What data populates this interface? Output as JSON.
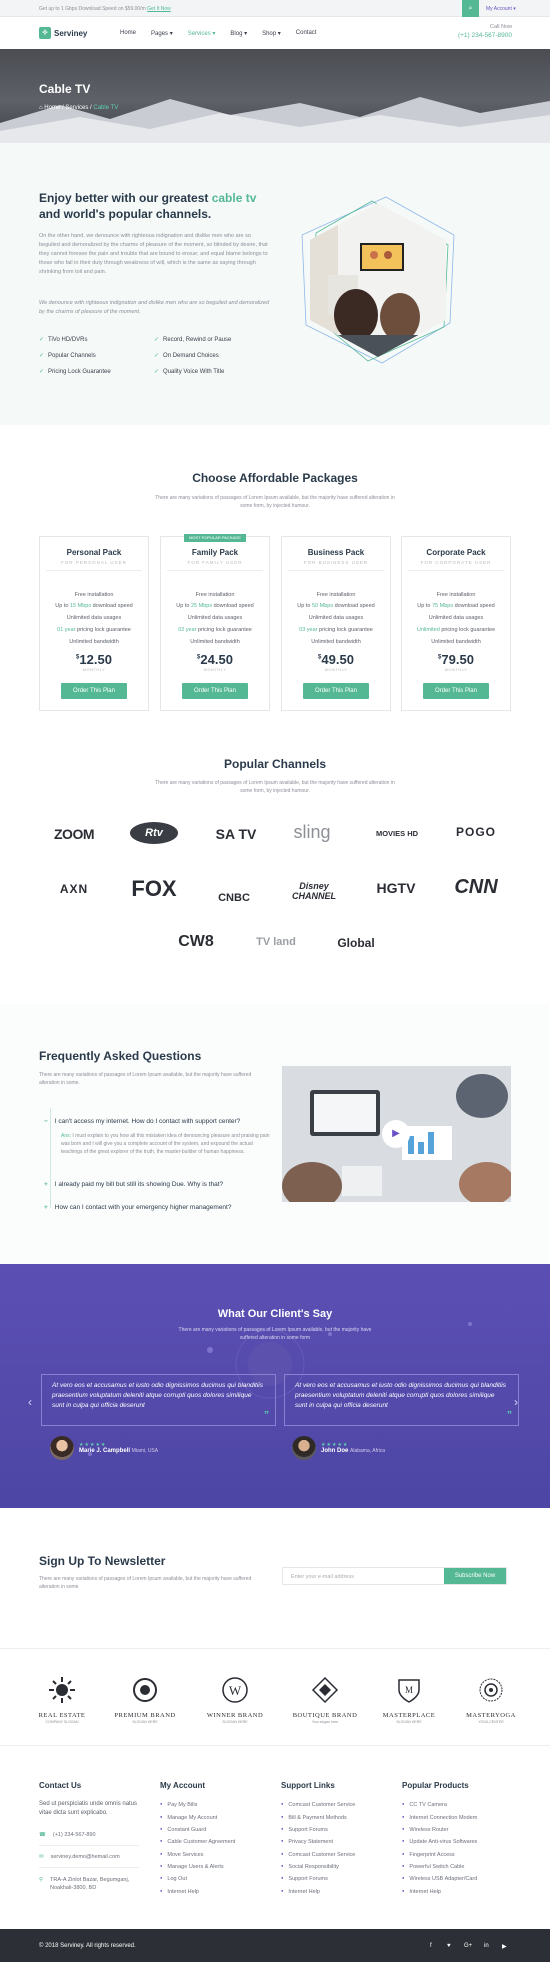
{
  "topbar": {
    "promo": "Get up to 1 Gbps Download Speed on $59.00/m",
    "promo_link": "Get It Now",
    "account": "My Account ▾"
  },
  "header": {
    "brand": "Servineу",
    "nav": [
      "Home",
      "Pages ▾",
      "Services ▾",
      "Blog ▾",
      "Shop ▾",
      "Contact"
    ],
    "call_label": "Call Now",
    "call_number": "(+1) 234-567-8900"
  },
  "hero": {
    "title": "Cable TV",
    "breadcrumb": [
      "Home",
      "/",
      "Services",
      "/",
      "Cable TV"
    ]
  },
  "about": {
    "title_a": "Enjoy better with our greatest ",
    "title_hl": "cable tv",
    "title_b": " and world's popular channels.",
    "para1": "On the other hand, we denounce with righteous indignation and dislike men who are so beguiled and demoralized by the charms of pleasure of the moment, so blinded by desire, that they cannot foresee the pain and trouble that are bound to ensue; and equal blame belongs to those who fail in their duty through weakness of will, which is the same as saying through shrinking from toil and pain.",
    "para2": "We denounce with righteous indignation and dislike men who are so beguiled and demoralized by the charms of pleasure of the moment.",
    "features": [
      "TiVo HD/DVRs",
      "Record, Rewind or Pause",
      "Popular Channels",
      "On Demand Choices",
      "Pricing Lock Guarantee",
      "Quality Voice With Title"
    ]
  },
  "packages": {
    "title": "Choose Affordable Packages",
    "subtitle": "There are many variations of passages of Lorem Ipsum available, but the majority have suffered alteration in some form, by injected humour.",
    "plans": [
      {
        "name": "Personal Pack",
        "sub": "FOR PERSONAL USER",
        "tag": "",
        "f1": "Free installation",
        "f2a": "Up to ",
        "f2b": "15 Mbps",
        "f2c": " download speed",
        "f3": "Unlimited data usages",
        "f4a": "01 year",
        "f4b": " pricing lock guarantee",
        "f5": "Unlimited bandwidth",
        "currency": "$",
        "price": "12.50",
        "period": "MONTHLY",
        "cta": "Order This Plan"
      },
      {
        "name": "Family Pack",
        "sub": "FOR FAMILY USER",
        "tag": "MOST POPULAR PACKAGE",
        "f1": "Free installation",
        "f2a": "Up to ",
        "f2b": "25 Mbps",
        "f2c": " download speed",
        "f3": "Unlimited data usages",
        "f4a": "02 year",
        "f4b": " pricing lock guarantee",
        "f5": "Unlimited bandwidth",
        "currency": "$",
        "price": "24.50",
        "period": "MONTHLY",
        "cta": "Order This Plan"
      },
      {
        "name": "Business Pack",
        "sub": "FOR BUSINESS USER",
        "tag": "",
        "f1": "Free installation",
        "f2a": "Up to ",
        "f2b": "50 Mbps",
        "f2c": " download speed",
        "f3": "Unlimited data usages",
        "f4a": "03 year",
        "f4b": " pricing lock guarantee",
        "f5": "Unlimited bandwidth",
        "currency": "$",
        "price": "49.50",
        "period": "MONTHLY",
        "cta": "Order This Plan"
      },
      {
        "name": "Corporate Pack",
        "sub": "FOR CORPORATE USER",
        "tag": "",
        "f1": "Free installation",
        "f2a": "Up to ",
        "f2b": "75 Mbps",
        "f2c": " download speed",
        "f3": "Unlimited data usages",
        "f4a": "Unlimited",
        "f4b": " pricing lock guarantee",
        "f5": "Unlimited bandwidth",
        "currency": "$",
        "price": "79.50",
        "period": "MONTHLY",
        "cta": "Order This Plan"
      }
    ]
  },
  "channels": {
    "title": "Popular Channels",
    "subtitle": "There are many variations of passages of Lorem Ipsum available, but the majority have suffered alteration in some form, by injected humour.",
    "logos": [
      "ZOOM",
      "Rtv",
      "SA TV",
      "sling",
      "MOVIES HD",
      "POGO",
      "AXN",
      "FOX",
      "CNBC",
      "Disney CHANNEL",
      "HGTV",
      "CNN",
      "CW8",
      "TV land",
      "Global"
    ]
  },
  "faq": {
    "title": "Frequently Asked Questions",
    "subtitle": "There are many variations of passages of Lorem Ipsum available, but the majority have suffered alteration in some.",
    "items": [
      {
        "q": "I can't access my internet. How do I contact with support center?",
        "open": true
      },
      {
        "q": "I already paid my bill but still its showing Due. Why is that?",
        "open": false
      },
      {
        "q": "How can I contact with your emergency higher management?",
        "open": false
      }
    ],
    "answer_hl": "Ans:",
    "answer": " I must explain to you how all this mistaken idea of denouncing pleasure and praising pain was born and I will give you a complete account of the system, and expound the actual teachings of the great explorer of the truth, the master-builder of human happiness."
  },
  "testimonials": {
    "title": "What Our Client's Say",
    "subtitle": "There are many variations of passages of Lorem Ipsum available, but the majority have suffered alteration in some form",
    "items": [
      {
        "quote": "At vero eos et accusamus et iusto odio dignissimos ducimus qui blanditiis praesentium voluptatum deleniti atque corrupti quos dolores similique sunt in culpa qui officia deserunt",
        "name": "Marie J. Campbell",
        "loc": "Miami, USA",
        "stars": "★★★★★"
      },
      {
        "quote": "At vero eos et accusamus et iusto odio dignissimos ducimus qui blanditiis praesentium voluptatum deleniti atque corrupti quos dolores similique sunt in culpa qui officia deserunt",
        "name": "John Doe",
        "loc": "Alabama, Africa",
        "stars": "★★★★★"
      }
    ]
  },
  "newsletter": {
    "title": "Sign Up To Newsletter",
    "subtitle": "There are many variations of passages of Lorem Ipsum available, but the majority have suffered alteration in some",
    "placeholder": "Enter your e-mail address",
    "cta": "Subscribe Now"
  },
  "brands": [
    {
      "name": "REAL ESTATE",
      "sub": "COMPANY SLOGAN"
    },
    {
      "name": "PREMIUM BRAND",
      "sub": "SLOGAN HERE"
    },
    {
      "name": "WINNER BRAND",
      "sub": "SLOGAN HERE"
    },
    {
      "name": "BOUTIQUE BRAND",
      "sub": "Your slogan here"
    },
    {
      "name": "MASTERPLACE",
      "sub": "SLOGAN HERE"
    },
    {
      "name": "MASTERYOGA",
      "sub": "YOGA CENTER"
    }
  ],
  "footer": {
    "contact_title": "Contact Us",
    "contact_text": "Sed ut perspiciatis unde omnis natus vitae dicta sunt explicabo.",
    "phone": "(+1) 234-567-890",
    "email": "serviney.demo@hemail.com",
    "address": "TRA-A Zinlot Bazar, Begumganj, Noakhali-3800, BD",
    "col2_title": "My Account",
    "col2": [
      "Pay My Bills",
      "Manage My Account",
      "Constant Guard",
      "Cable Customer Agreement",
      "Move Services",
      "Manage Users & Alerts",
      "Log Out",
      "Internet Help"
    ],
    "col3_title": "Support Links",
    "col3": [
      "Comcast Customer Service",
      "Bill & Payment Methods",
      "Support Forums",
      "Privacy Statement",
      "Comcast Customer Service",
      "Social Responsibility",
      "Support Forums",
      "Internet Help"
    ],
    "col4_title": "Popular Products",
    "col4": [
      "CC TV Camera",
      "Internet Connection Modem",
      "Wireless Router",
      "Update Anti-virus Softwares",
      "Fingerprint Access",
      "Powerful Switch Cable",
      "Wireless USB Adapter/Card",
      "Internet Help"
    ],
    "copyright": "© 2018 Serviney. All rights reserved.",
    "social": [
      "f",
      "♥",
      "G+",
      "in",
      "▶"
    ]
  },
  "colors": {
    "accent": "#55b894",
    "purple": "#6a52c4",
    "dark": "#2c2f35"
  }
}
